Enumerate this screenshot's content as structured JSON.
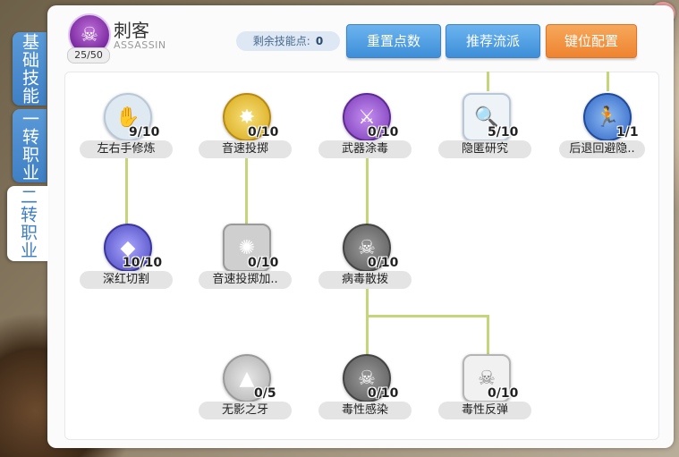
{
  "header": {
    "class_name": "刺客",
    "class_name_en": "ASSASSIN",
    "class_level": "25/50",
    "points_label": "剩余技能点:",
    "points_value": "0",
    "buttons": {
      "reset": "重置点数",
      "recommend": "推荐流派",
      "keybind": "键位配置"
    }
  },
  "tabs": [
    {
      "label": "基础技能"
    },
    {
      "label": "一转职业"
    },
    {
      "label": "二转职业"
    }
  ],
  "skills": [
    {
      "id": "s1",
      "name": "左右手修炼",
      "level": "9/10",
      "icon": "hands-icon",
      "color": "#dfe9f2"
    },
    {
      "id": "s2",
      "name": "音速投掷",
      "level": "0/10",
      "icon": "sonic-blow-icon",
      "color": "#e6c23a"
    },
    {
      "id": "s3",
      "name": "武器涂毒",
      "level": "0/10",
      "icon": "poison-weapon-icon",
      "color": "#9a55d6"
    },
    {
      "id": "s4",
      "name": "隐匿研究",
      "level": "5/10",
      "icon": "hiding-research-icon",
      "color": "#e3ebf3"
    },
    {
      "id": "s5",
      "name": "后退回避隐..",
      "level": "1/1",
      "icon": "back-slide-icon",
      "color": "#4c7fd6"
    },
    {
      "id": "s6",
      "name": "深红切割",
      "level": "10/10",
      "icon": "crimson-cut-icon",
      "color": "#6f6bd8"
    },
    {
      "id": "s7",
      "name": "音速投掷加..",
      "level": "0/10",
      "icon": "sonic-accel-icon",
      "color": "#b5b5b5"
    },
    {
      "id": "s8",
      "name": "病毒散拨",
      "level": "0/10",
      "icon": "virus-spread-icon",
      "color": "#8c8c8c"
    },
    {
      "id": "s9",
      "name": "无影之牙",
      "level": "0/5",
      "icon": "shadow-fang-icon",
      "color": "#d2d2d2"
    },
    {
      "id": "s10",
      "name": "毒性感染",
      "level": "0/10",
      "icon": "toxic-infection-icon",
      "color": "#8c8c8c"
    },
    {
      "id": "s11",
      "name": "毒性反弹",
      "level": "0/10",
      "icon": "poison-react-icon",
      "color": "#e0e0e0"
    }
  ]
}
